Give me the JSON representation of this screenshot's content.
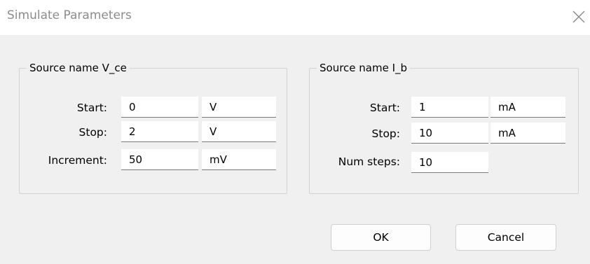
{
  "window": {
    "title": "Simulate Parameters",
    "close_icon": "close-icon"
  },
  "left_group": {
    "legend": "Source name V_ce",
    "rows": [
      {
        "label": "Start:",
        "value": "0",
        "unit": "V"
      },
      {
        "label": "Stop:",
        "value": "2",
        "unit": "V"
      },
      {
        "label": "Increment:",
        "value": "50",
        "unit": "mV"
      }
    ]
  },
  "right_group": {
    "legend": "Source name I_b",
    "rows": [
      {
        "label": "Start:",
        "value": "1",
        "unit": "mA"
      },
      {
        "label": "Stop:",
        "value": "10",
        "unit": "mA"
      },
      {
        "label": "Num steps:",
        "value": "10"
      }
    ]
  },
  "buttons": {
    "ok": "OK",
    "cancel": "Cancel"
  },
  "colors": {
    "dialog_bg": "#f0f0f0",
    "titlebar_bg": "#ffffff",
    "title_text": "#8c8c8c"
  }
}
